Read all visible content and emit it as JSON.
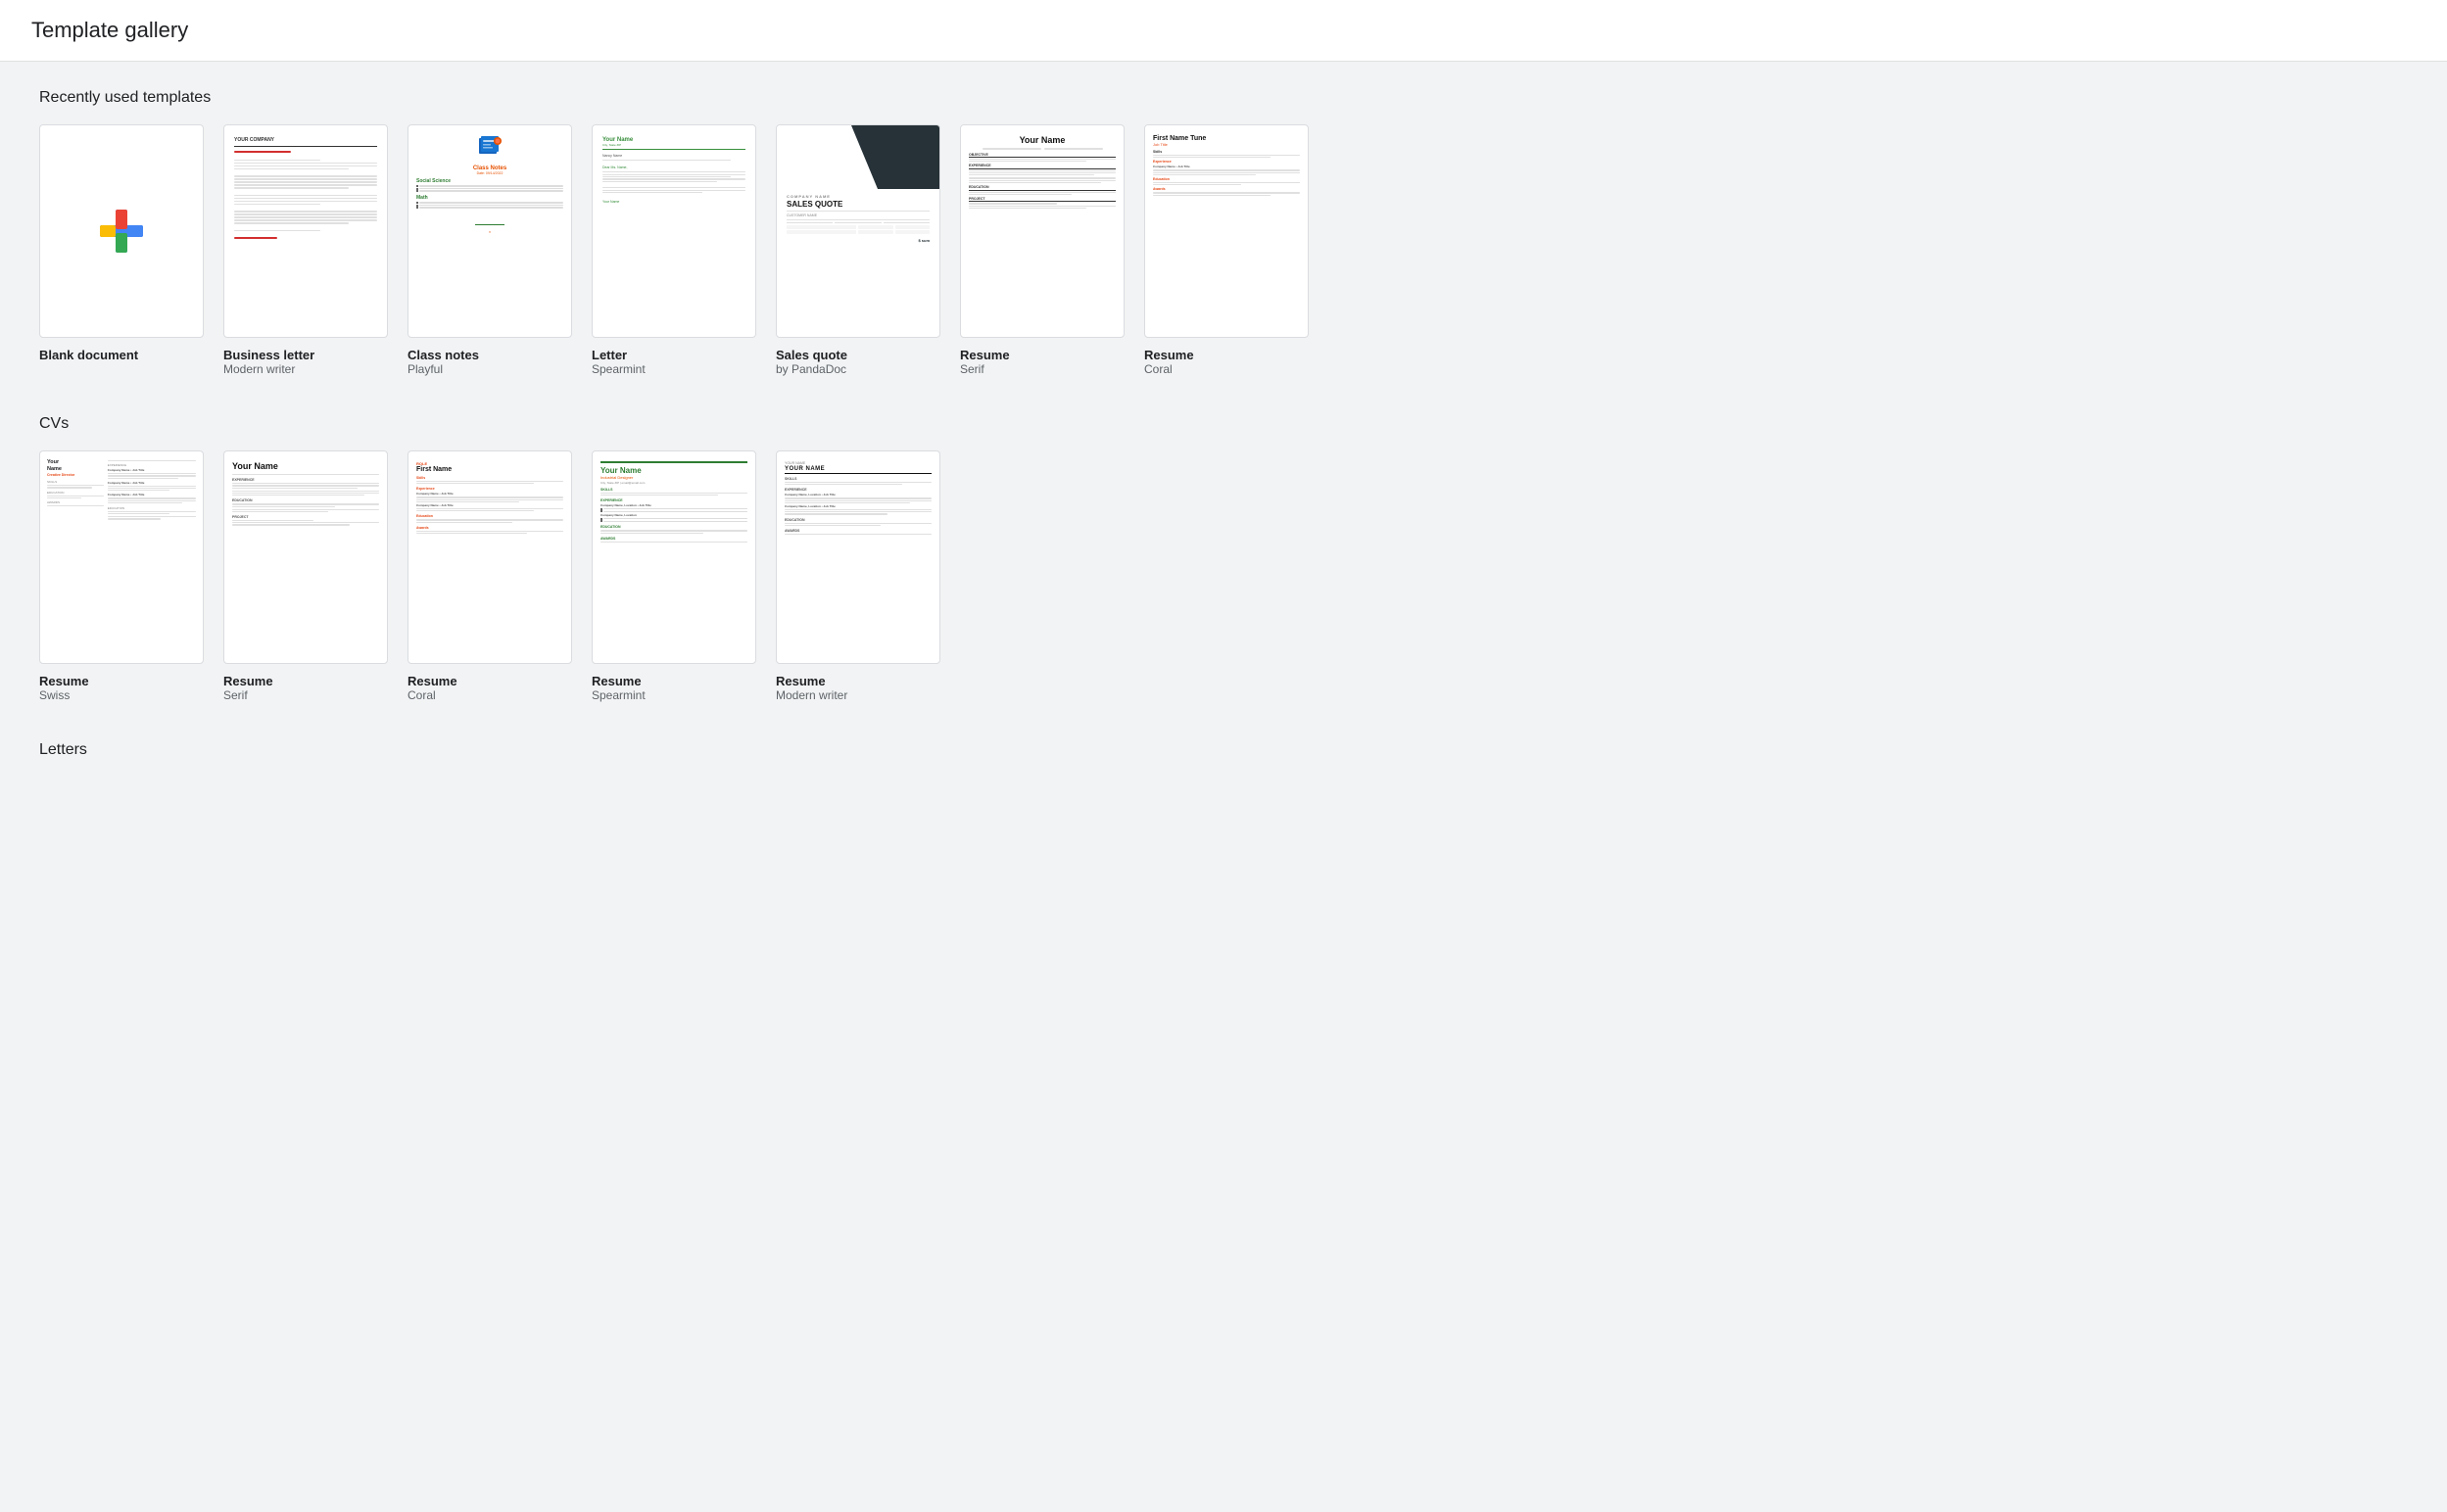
{
  "page": {
    "title": "Template gallery"
  },
  "recently_used": {
    "section_title": "Recently used templates",
    "templates": [
      {
        "id": "blank",
        "label": "Blank document",
        "sublabel": ""
      },
      {
        "id": "business-letter",
        "label": "Business letter",
        "sublabel": "Modern writer"
      },
      {
        "id": "class-notes",
        "label": "Class notes",
        "sublabel": "Playful"
      },
      {
        "id": "letter",
        "label": "Letter",
        "sublabel": "Spearmint"
      },
      {
        "id": "sales-quote",
        "label": "Sales quote",
        "sublabel": "by PandaDoc"
      },
      {
        "id": "resume-serif",
        "label": "Resume",
        "sublabel": "Serif"
      },
      {
        "id": "resume-coral",
        "label": "Resume",
        "sublabel": "Coral"
      }
    ]
  },
  "cvs": {
    "section_title": "CVs",
    "templates": [
      {
        "id": "cv-swiss",
        "label": "Resume",
        "sublabel": "Swiss"
      },
      {
        "id": "cv-serif",
        "label": "Resume",
        "sublabel": "Serif"
      },
      {
        "id": "cv-coral",
        "label": "Resume",
        "sublabel": "Coral"
      },
      {
        "id": "cv-spearmint",
        "label": "Resume",
        "sublabel": "Spearmint"
      },
      {
        "id": "cv-modern",
        "label": "Resume",
        "sublabel": "Modern writer"
      }
    ]
  },
  "letters": {
    "section_title": "Letters"
  }
}
